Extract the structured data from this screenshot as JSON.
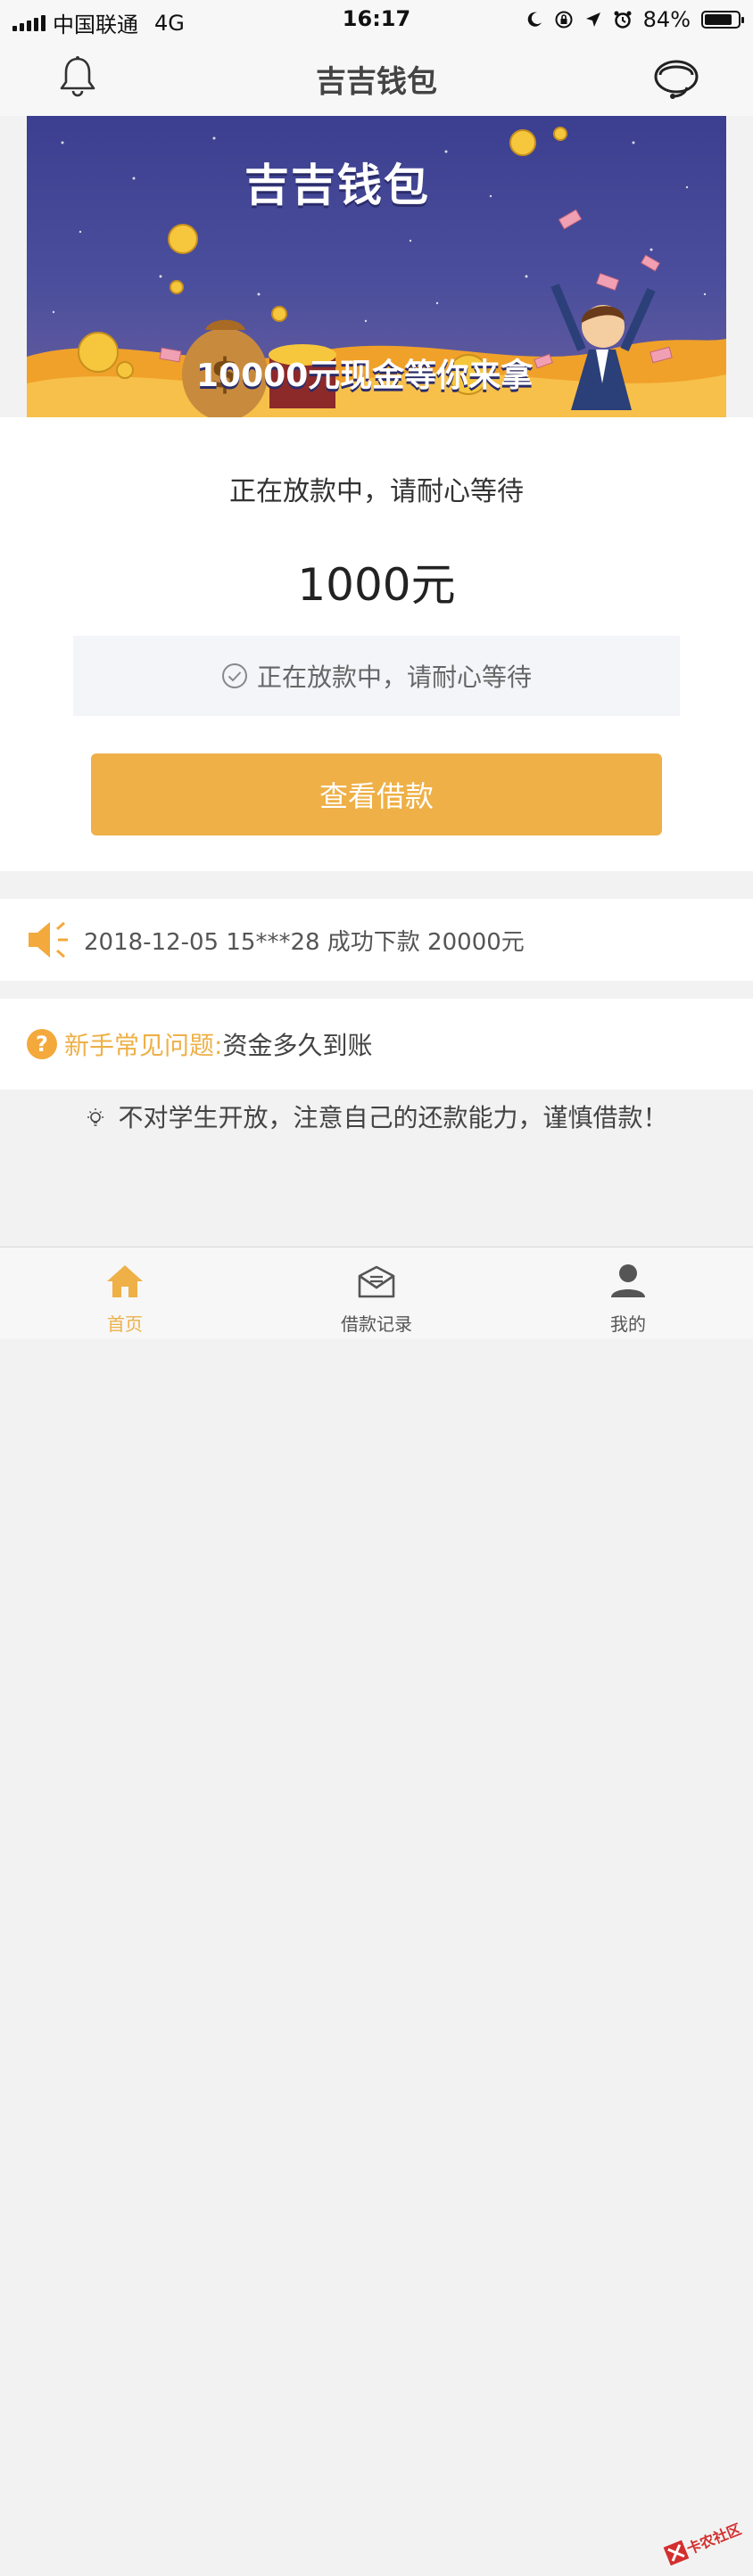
{
  "status_bar": {
    "carrier": "中国联通",
    "network": "4G",
    "time": "16:17",
    "battery": "84%",
    "battery_level": 0.84
  },
  "navbar": {
    "title": "吉吉钱包"
  },
  "banner": {
    "title": "吉吉钱包",
    "subtitle": "10000元现金等你来拿"
  },
  "loan": {
    "status_text": "正在放款中，请耐心等待",
    "amount": "1000元",
    "notice": "正在放款中，请耐心等待",
    "view_button": "查看借款"
  },
  "ticker": {
    "text": "2018-12-05 15***28 成功下款 20000元"
  },
  "faq": {
    "label": "新手常见问题:",
    "value": "资金多久到账"
  },
  "tip": {
    "text": "不对学生开放，注意自己的还款能力，谨慎借款！"
  },
  "tabs": [
    {
      "label": "首页",
      "icon": "home-icon",
      "active": true
    },
    {
      "label": "借款记录",
      "icon": "mail-icon",
      "active": false
    },
    {
      "label": "我的",
      "icon": "user-icon",
      "active": false
    }
  ],
  "watermark": {
    "text": "卡农社区"
  },
  "colors": {
    "accent": "#eeb047",
    "banner_bg": "#3c3f8f",
    "background": "#f2f2f2"
  }
}
